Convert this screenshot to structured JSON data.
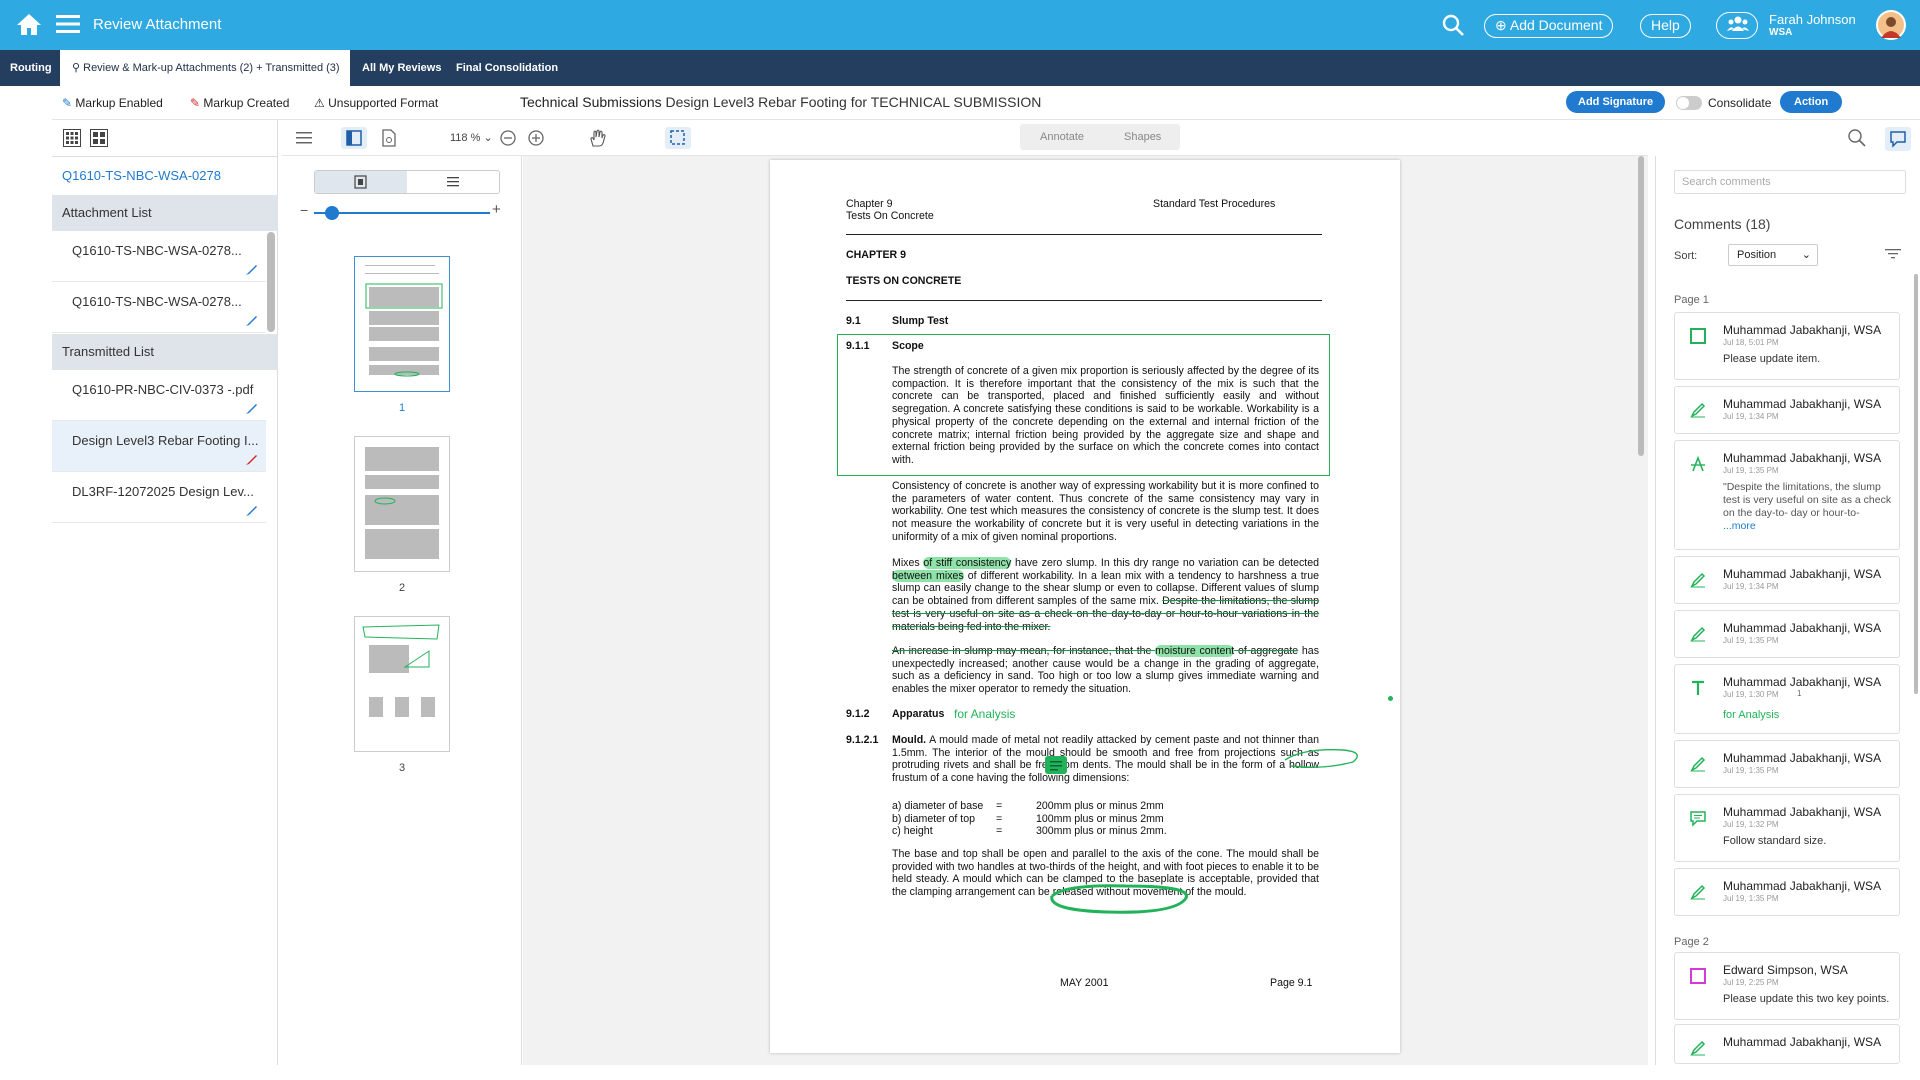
{
  "header": {
    "title": "Review Attachment",
    "add_document": "Add Document",
    "help": "Help",
    "user_name": "Farah Johnson",
    "user_org": "WSA"
  },
  "tabs": [
    "Routing",
    "Review & Mark-up Attachments (2) + Transmitted (3)",
    "All My Reviews",
    "Final Consolidation"
  ],
  "toolbar": {
    "markup_enabled": "Markup Enabled",
    "markup_created": "Markup Created",
    "unsupported": "Unsupported Format",
    "doc_title_bold": "Technical Submissions",
    "doc_title": "Design Level3 Rebar Footing for TECHNICAL SUBMISSION",
    "add_signature": "Add Signature",
    "consolidate": "Consolidate",
    "action": "Action"
  },
  "left": {
    "ref": "Q1610-TS-NBC-WSA-0278",
    "attachment_head": "Attachment List",
    "attachments": [
      "Q1610-TS-NBC-WSA-0278...",
      "Q1610-TS-NBC-WSA-0278..."
    ],
    "transmitted_head": "Transmitted List",
    "transmitted": [
      "Q1610-PR-NBC-CIV-0373 -.pdf",
      "Design Level3 Rebar Footing I...",
      "DL3RF-12072025 Design Lev..."
    ]
  },
  "viewer": {
    "zoom": "118 %",
    "annotate": "Annotate",
    "shapes": "Shapes",
    "zoom_fraction": 0.1
  },
  "thumbs": [
    "1",
    "2",
    "3"
  ],
  "doc": {
    "chapter": "Chapter 9",
    "tests": "Tests On Concrete",
    "std": "Standard Test Procedures",
    "ch_head": "CHAPTER 9",
    "tests_head": "TESTS ON CONCRETE",
    "s91": "9.1",
    "s91t": "Slump Test",
    "s911": "9.1.1",
    "s911t": "Scope",
    "p1": "The strength of concrete of a given mix proportion is seriously affected by the degree of its compaction. It is therefore important that the consistency of the mix is such that the concrete can be transported, placed and finished sufficiently easily and without segregation. A concrete satisfying these conditions is said to be workable. Workability is a physical property of the concrete depending on the external and internal friction of the concrete matrix; internal friction being provided by the aggregate size and shape and external friction being provided by the surface on which the concrete comes into contact with.",
    "p2": "Consistency of concrete is another way of expressing workability but it is more confined to the parameters of water content. Thus concrete of the same consistency may vary in workability. One test which measures the consistency of concrete is the slump test. It does not measure the workability of concrete but it is very useful in detecting variations in the uniformity of a mix of given nominal proportions.",
    "p3a": "Mixes ",
    "p3hl": "of stiff consistency",
    "p3b": " have zero slump. In this dry range no variation can be detected ",
    "p3hl2": "between mixes",
    "p3c": " of different workability. In a lean mix with a tendency to harshness a true slump can easily change to the shear slump or even to collapse. Different values of slump can be obtained from different samples of the same mix. ",
    "p3s": "Despite the limitations, the slump test is very useful on site as a check on the day-to-day or hour-to-hour variations in the materials being fed into the mixer.",
    "p4s": "An increase in slump may mean, for instance, that the ",
    "p4hl": "moisture content",
    "p4s2": " of aggregate",
    "p4": " has unexpectedly increased; another cause would be a change in the grading of aggregate, such as a deficiency in sand. Too high or too low a slump gives immediate warning and enables the mixer operator to remedy the situation.",
    "s912": "9.1.2",
    "s912t": "Apparatus",
    "s912note": "for Analysis",
    "s9121": "9.1.2.1",
    "mould": "Mould.",
    "p5": " A mould made of metal not readily attacked by cement paste and not thinner than 1.5mm. The interior of the mould should be smooth and free from projections such as protruding rivets and shall be free from dents. The mould shall be in the form of a hollow frustum of a cone having the following dimensions:",
    "dims": [
      [
        "a) diameter of base",
        "=",
        "200mm plus or minus 2mm"
      ],
      [
        "b) diameter of top",
        "=",
        "100mm plus or minus 2mm"
      ],
      [
        "c) height",
        "=",
        "300mm plus or minus 2mm."
      ]
    ],
    "p6": "The base and top shall be open and parallel to the axis of the cone. The mould shall be provided with two handles at two-thirds of the height, and with foot pieces to enable it to be held steady. A mould which can be clamped to the baseplate is acceptable, provided that the clamping arrangement can be released without movement of the mould.",
    "footer_date": "MAY 2001",
    "footer_page": "Page 9.1"
  },
  "comments": {
    "search_placeholder": "Search comments",
    "title": "Comments (18)",
    "sort_label": "Sort:",
    "sort_value": "Position",
    "page1": "Page 1",
    "page2": "Page 2",
    "items": [
      {
        "name": "Muhammad Jabakhanji, WSA",
        "date": "Jul 18, 5:01 PM",
        "body": "Please update item.",
        "icon": "square-icon"
      },
      {
        "name": "Muhammad Jabakhanji, WSA",
        "date": "Jul 19, 1:34 PM",
        "body": "",
        "icon": "pencil-icon"
      },
      {
        "name": "Muhammad Jabakhanji, WSA",
        "date": "Jul 19, 1:35 PM",
        "body": "\"Despite the limitations, the slump test is very useful on site as a check on the day-to- day or hour-to- ",
        "more": "...more",
        "icon": "strikeout-icon"
      },
      {
        "name": "Muhammad Jabakhanji, WSA",
        "date": "Jul 19, 1:34 PM",
        "body": "",
        "icon": "pencil-icon"
      },
      {
        "name": "Muhammad Jabakhanji, WSA",
        "date": "Jul 19, 1:35 PM",
        "body": "",
        "icon": "pencil-icon"
      },
      {
        "name": "Muhammad Jabakhanji, WSA",
        "date": "Jul 19, 1:30 PM",
        "body": "for Analysis",
        "replies": "1",
        "icon": "text-icon"
      },
      {
        "name": "Muhammad Jabakhanji, WSA",
        "date": "Jul 19, 1:35 PM",
        "body": "",
        "icon": "pencil-icon"
      },
      {
        "name": "Muhammad Jabakhanji, WSA",
        "date": "Jul 19, 1:32 PM",
        "body": "Follow standard size.",
        "icon": "note-icon"
      },
      {
        "name": "Muhammad Jabakhanji, WSA",
        "date": "Jul 19, 1:35 PM",
        "body": "",
        "icon": "pencil-icon"
      },
      {
        "name": "Edward Simpson, WSA",
        "date": "Jul 19, 2:25 PM",
        "body": "Please update this two key points.",
        "icon": "square-icon"
      },
      {
        "name": "Muhammad Jabakhanji, WSA",
        "date": "",
        "body": "",
        "icon": "pencil-icon"
      }
    ]
  },
  "colors": {
    "header": "#2fa9e1",
    "tabbar": "#243e5f",
    "accent": "#1f7ad0",
    "markup_green": "#22b35a",
    "highlight": "#8fe3a8"
  }
}
